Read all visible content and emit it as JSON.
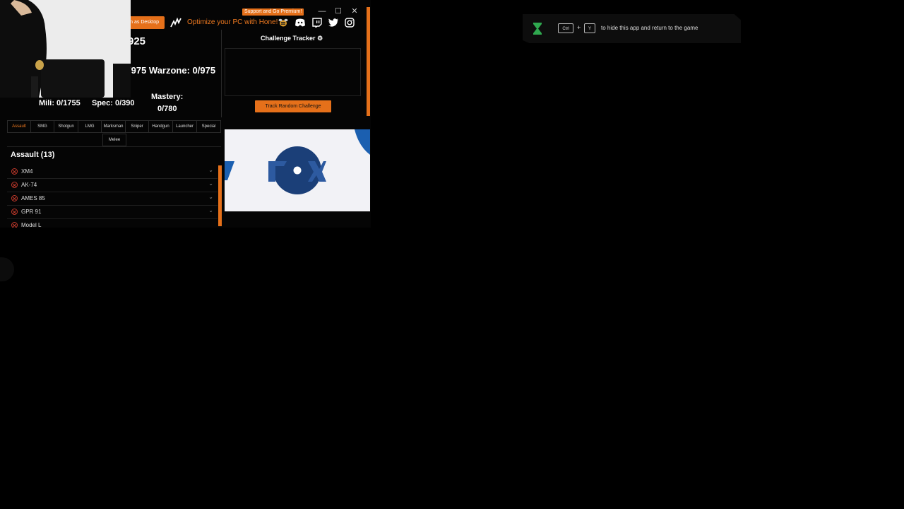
{
  "app": {
    "premium_button": "Support and Go Premium!",
    "desktop_button": "n as Desktop",
    "hone_link": "Optimize your PC with Hone!",
    "icons": [
      "minimize-icon",
      "maximize-icon",
      "close-icon",
      "hone-icon",
      "bee-icon",
      "discord-icon",
      "twitch-icon",
      "twitter-icon",
      "instagram-icon"
    ]
  },
  "stats": {
    "top_partial": "925",
    "row2": "/975 Warzone: 0/975",
    "mili": "Mili: 0/1755",
    "spec": "Spec: 0/390",
    "mastery_label": "Mastery:",
    "mastery_value": "0/780"
  },
  "tabs": [
    "Assault",
    "SMG",
    "Shotgun",
    "LMG",
    "Marksman",
    "Sniper",
    "Handgun",
    "Launcher",
    "Special",
    "Melee"
  ],
  "active_tab": "Assault",
  "section": {
    "title": "Assault (13)"
  },
  "weapons": [
    "XM4",
    "AK-74",
    "AMES 85",
    "GPR 91",
    "Model L"
  ],
  "tracker": {
    "title": "Challenge Tracker",
    "button": "Track Random Challenge"
  },
  "hint": {
    "key1": "Ctrl",
    "plus": "+",
    "key2": "Y",
    "text": "to hide this app and return to the game"
  },
  "colors": {
    "accent": "#e5701a",
    "background": "#000000",
    "error": "#c0392b",
    "ad_blue": "#1b3f78"
  }
}
